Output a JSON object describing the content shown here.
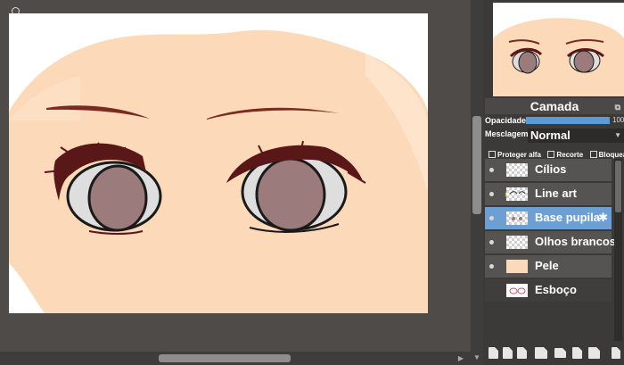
{
  "layer_panel": {
    "title": "Camada",
    "opacity_label": "Opacidade",
    "opacity_value": "100",
    "opacity_fraction": 1.0,
    "blend_label": "Mesclagem",
    "blend_mode": "Normal",
    "options": [
      "Proteger alfa",
      "Recorte",
      "Bloquear"
    ],
    "layers": [
      {
        "name": "Cílios",
        "visible": true,
        "thumb": "checker"
      },
      {
        "name": "Line art",
        "visible": true,
        "locked": true,
        "thumb": "checker"
      },
      {
        "name": "Base pupila",
        "visible": true,
        "selected": true,
        "thumb": "checker"
      },
      {
        "name": "Olhos brancos",
        "visible": true,
        "thumb": "checker"
      },
      {
        "name": "Pele",
        "visible": true,
        "thumb": "skin"
      },
      {
        "name": "Esboço",
        "visible": false,
        "thumb": "sketch"
      }
    ]
  },
  "colors": {
    "skin": "#fcd9b8",
    "pupil": "#9b7b7b",
    "lash": "#5a1718",
    "eye_white": "#dedede",
    "accent": "#6d9fd2",
    "workspace": "#4e4b49"
  },
  "icons": {
    "bottom_toolbar": [
      "new-layer-icon",
      "new-layer-icon",
      "copy-layer-icon",
      "add-special-layer-icon",
      "folder-icon",
      "duplicate-icon",
      "merge-down-icon",
      "delete-icon"
    ]
  }
}
